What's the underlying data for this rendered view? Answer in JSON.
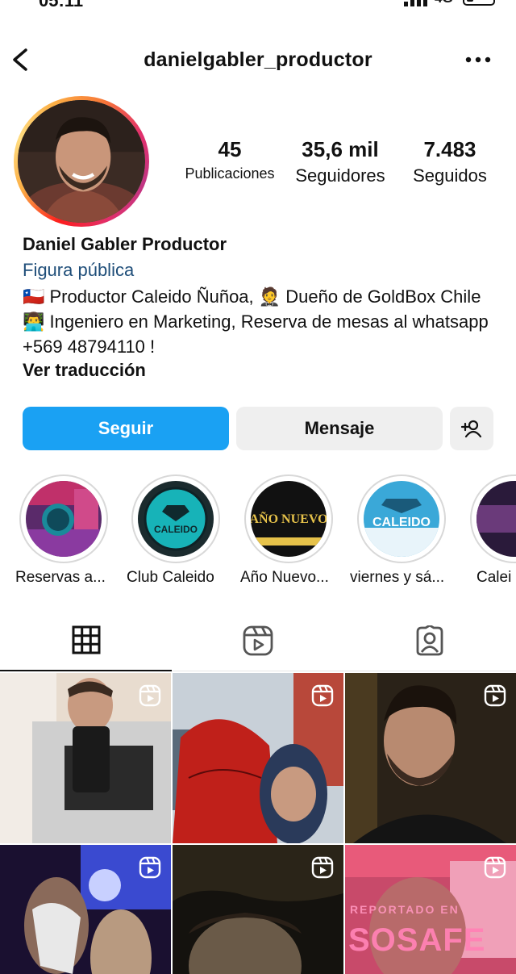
{
  "status_bar": {
    "time": "05:11",
    "network": "4G"
  },
  "header": {
    "username": "danielgabler_productor"
  },
  "profile": {
    "stats": [
      {
        "value": "45",
        "label": "Publicaciones"
      },
      {
        "value": "35,6 mil",
        "label": "Seguidores"
      },
      {
        "value": "7.483",
        "label": "Seguidos"
      }
    ],
    "name": "Daniel Gabler Productor",
    "category": "Figura pública",
    "bio": "🇨🇱 Productor Caleido Ñuñoa, 🤵 Dueño de GoldBox Chile 👨‍💻 Ingeniero en Marketing, Reserva de mesas al whatsapp +569 48794110 !",
    "translate_label": "Ver traducción"
  },
  "actions": {
    "follow_label": "Seguir",
    "message_label": "Mensaje"
  },
  "highlights": [
    {
      "label": "Reservas a..."
    },
    {
      "label": "Club Caleido",
      "image_text": "CALEIDO"
    },
    {
      "label": "Año Nuevo...",
      "image_text": "AÑO NUEVO"
    },
    {
      "label": "viernes y sá...",
      "image_text": "CALEIDO"
    },
    {
      "label": "Calei"
    }
  ],
  "tabs": [
    {
      "name": "grid",
      "icon": "grid-icon",
      "active": true
    },
    {
      "name": "reels",
      "icon": "reels-icon",
      "active": false
    },
    {
      "name": "tagged",
      "icon": "tagged-icon",
      "active": false
    }
  ],
  "grid": {
    "watermark_text": "REPORTADO EN",
    "watermark_logo": "SOSAFE"
  },
  "colors": {
    "follow_button": "#1aa1f3",
    "secondary_button": "#efefef",
    "category_link": "#1f4e79"
  }
}
